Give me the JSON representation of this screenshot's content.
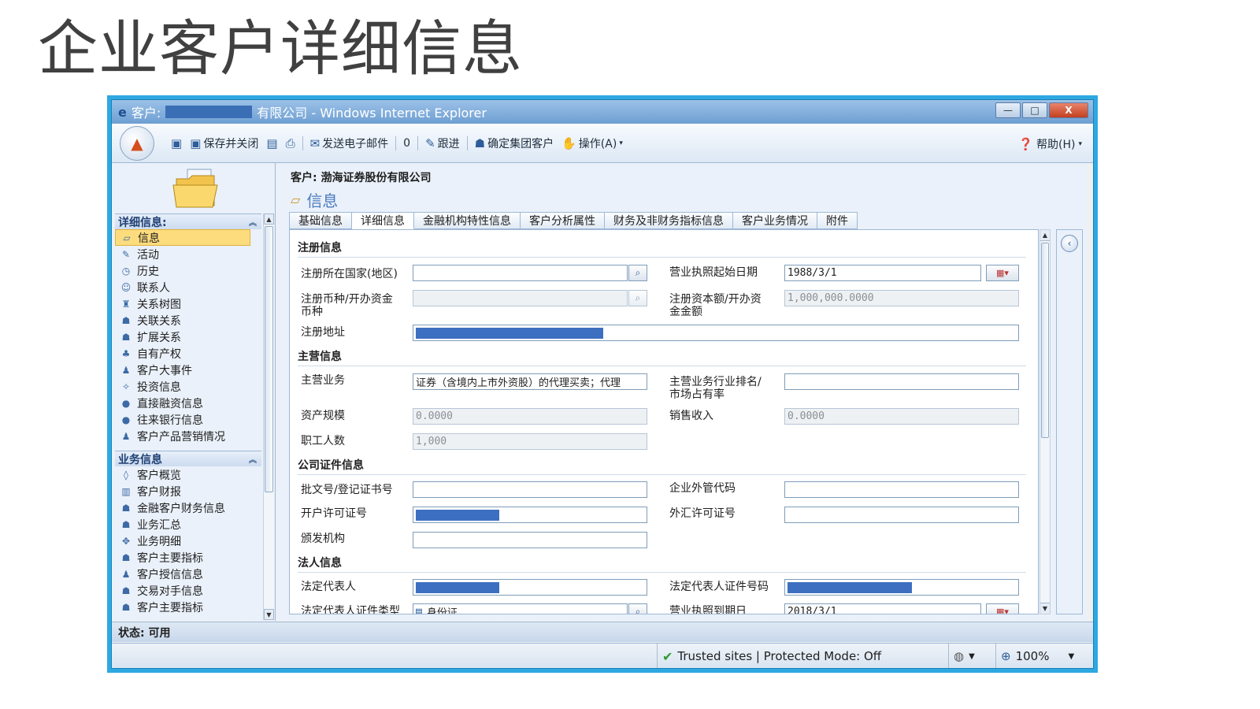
{
  "slide": {
    "title": "企业客户详细信息"
  },
  "window": {
    "title_prefix": "客户:",
    "title_suffix": "有限公司 - Windows Internet Explorer",
    "minimize": "—",
    "maximize": "□",
    "close": "X"
  },
  "toolbar": {
    "save_close": "保存并关闭",
    "send_email": "发送电子邮件",
    "attach": "0",
    "follow_up": "跟进",
    "confirm_group": "确定集团客户",
    "actions": "操作(A)",
    "help": "帮助(H)"
  },
  "record": {
    "name": "客户: 渤海证券股份有限公司",
    "section": "信息"
  },
  "sidebar": {
    "group1_title": "详细信息:",
    "group1_items": [
      "信息",
      "活动",
      "历史",
      "联系人",
      "关系树图",
      "关联关系",
      "扩展关系",
      "自有产权",
      "客户大事件",
      "投资信息",
      "直接融资信息",
      "往来银行信息",
      "客户产品营销情况"
    ],
    "group2_title": "业务信息",
    "group2_items": [
      "客户概览",
      "客户财报",
      "金融客户财务信息",
      "业务汇总",
      "业务明细",
      "客户主要指标",
      "客户授信信息",
      "交易对手信息",
      "客户主要指标"
    ]
  },
  "tabs": [
    "基础信息",
    "详细信息",
    "金融机构特性信息",
    "客户分析属性",
    "财务及非财务指标信息",
    "客户业务情况",
    "附件"
  ],
  "form": {
    "sec_registration": "注册信息",
    "reg_country_label": "注册所在国家(地区)",
    "reg_country_value": "",
    "license_start_label": "营业执照起始日期",
    "license_start_value": "1988/3/1",
    "reg_currency_label_1": "注册币种/开办资金",
    "reg_currency_label_2": "币种",
    "reg_capital_label_1": "注册资本额/开办资",
    "reg_capital_label_2": "金金额",
    "reg_capital_value": "1,000,000.0000",
    "reg_address_label": "注册地址",
    "sec_main": "主营信息",
    "main_business_label": "主营业务",
    "main_business_value": "证券（含境内上市外资股）的代理买卖；代理",
    "industry_rank_label_1": "主营业务行业排名/",
    "industry_rank_label_2": "市场占有率",
    "asset_scale_label": "资产规模",
    "asset_scale_value": "0.0000",
    "sales_income_label": "销售收入",
    "sales_income_value": "0.0000",
    "employees_label": "职工人数",
    "employees_value": "1,000",
    "sec_cert": "公司证件信息",
    "approval_no_label": "批文号/登记证书号",
    "foreign_code_label": "企业外管代码",
    "account_permit_label": "开户许可证号",
    "fx_permit_label": "外汇许可证号",
    "issuer_label": "颁发机构",
    "sec_legal": "法人信息",
    "legal_rep_label": "法定代表人",
    "legal_rep_id_label": "法定代表人证件号码",
    "legal_rep_idtype_label": "法定代表人证件类型",
    "legal_rep_idtype_value": "身份证",
    "license_end_label": "营业执照到期日",
    "license_end_value": "2018/3/1"
  },
  "status": {
    "record_status": "状态: 可用",
    "trusted": "Trusted sites | Protected Mode: Off",
    "zoom": "100%"
  }
}
